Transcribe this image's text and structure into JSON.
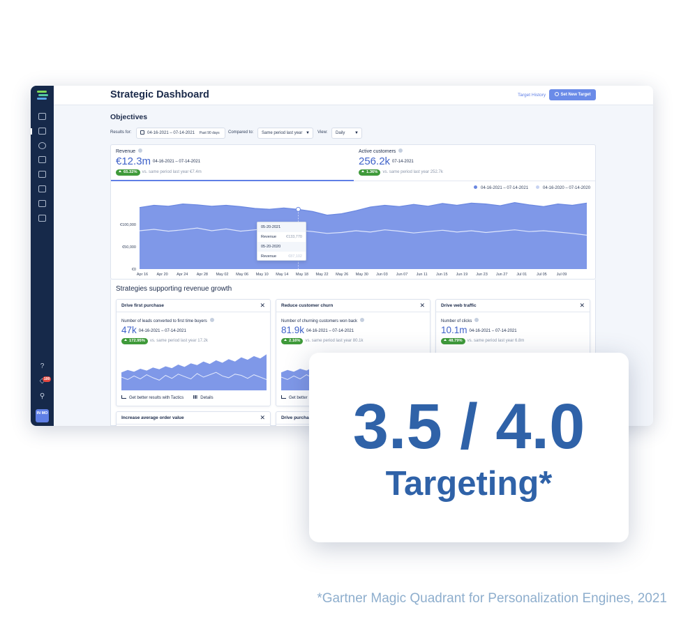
{
  "app": {
    "page_title": "Strategic Dashboard",
    "target_history": "Target History",
    "new_target_button": "Set New Target",
    "notification_count": "100",
    "avatar_initials": "IN MO"
  },
  "objectives": {
    "title": "Objectives",
    "filters": {
      "results_for_label": "Results for:",
      "date_range": "04-16-2021 – 07-14-2021",
      "date_hint": "Past 90 days",
      "compared_to_label": "Compared to:",
      "compared_value": "Same period last year",
      "view_label": "View:",
      "view_value": "Daily"
    },
    "kpis": [
      {
        "label": "Revenue",
        "value": "€12.3m",
        "range": "04-16-2021 – 07-14-2021",
        "delta": "65.32%",
        "compare_text": "vs. same period last year €7.4m"
      },
      {
        "label": "Active customers",
        "value": "256.2k",
        "range": "07-14-2021",
        "delta": "1.36%",
        "compare_text": "vs. same period last year 252.7k"
      }
    ],
    "legend": [
      {
        "name": "04-16-2021 – 07-14-2021",
        "color": "#6a87e0"
      },
      {
        "name": "04-16-2020 – 07-14-2020",
        "color": "#c7d3f2"
      }
    ],
    "tooltip": {
      "date_current": "05-20-2021",
      "label_current": "Revenue",
      "value_current": "€133,770",
      "date_previous": "05-20-2020",
      "label_previous": "Revenue",
      "value_previous": "€87,102"
    }
  },
  "chart_data": {
    "type": "area",
    "title": "",
    "xlabel": "",
    "ylabel": "",
    "ylim": [
      0,
      175000
    ],
    "y_ticks": [
      0,
      50000,
      100000
    ],
    "y_tick_labels": [
      "€0",
      "€50,000",
      "€100,000"
    ],
    "x_tick_labels": [
      "Apr 16",
      "Apr 20",
      "Apr 24",
      "Apr 28",
      "May 02",
      "May 06",
      "May 10",
      "May 14",
      "May 18",
      "May 22",
      "May 26",
      "May 30",
      "Jun 03",
      "Jun 07",
      "Jun 11",
      "Jun 15",
      "Jun 19",
      "Jun 23",
      "Jun 27",
      "Jul 01",
      "Jul 05",
      "Jul 09"
    ],
    "grid": false,
    "legend_position": "top-right",
    "series": [
      {
        "name": "04-16-2021 – 07-14-2021",
        "values": [
          138000,
          143000,
          141000,
          146000,
          144000,
          141000,
          143000,
          140000,
          136000,
          134000,
          137000,
          133770,
          129000,
          121000,
          124000,
          131000,
          139000,
          143000,
          140000,
          145000,
          141000,
          147000,
          143000,
          148000,
          146000,
          142000,
          149000,
          144000,
          140000,
          146000,
          143000,
          148000
        ]
      },
      {
        "name": "04-16-2020 – 07-14-2020",
        "values": [
          86000,
          89000,
          85000,
          88000,
          92000,
          86000,
          90000,
          85000,
          88000,
          91000,
          87000,
          87102,
          84000,
          80000,
          82000,
          86000,
          83000,
          88000,
          85000,
          81000,
          84000,
          87000,
          83000,
          86000,
          82000,
          85000,
          88000,
          84000,
          86000,
          83000,
          80000,
          76000
        ]
      }
    ]
  },
  "strategies": {
    "title": "Strategies supporting revenue growth",
    "cards": [
      {
        "title": "Drive first purchase",
        "metric": "Number of leads converted to first time buyers",
        "value": "47k",
        "range": "04-16-2021 – 07-14-2021",
        "delta": "172.95%",
        "compare_text": "vs. same period last year 17.2k",
        "tactics_link": "Get better results with Tactics",
        "details_link": "Details"
      },
      {
        "title": "Reduce customer churn",
        "metric": "Number of churning customers won back",
        "value": "81.9k",
        "range": "04-16-2021 – 07-14-2021",
        "delta": "2.16%",
        "compare_text": "vs. same period last year 80.1k",
        "tactics_link": "Get better",
        "details_link": ""
      },
      {
        "title": "Drive web traffic",
        "metric": "Number of clicks",
        "value": "10.1m",
        "range": "04-16-2021 – 07-14-2021",
        "delta": "48.79%",
        "compare_text": "vs. same period last year 6.8m",
        "tactics_link": "",
        "details_link": ""
      },
      {
        "title": "Increase average order value"
      },
      {
        "title": "Drive purcha"
      }
    ],
    "card_sparkline": {
      "current": [
        30,
        34,
        31,
        36,
        33,
        38,
        35,
        40,
        37,
        43,
        39,
        45,
        42,
        48,
        44,
        50,
        46,
        52,
        48,
        55,
        51,
        57,
        53,
        60
      ],
      "previous": [
        22,
        18,
        24,
        19,
        26,
        21,
        17,
        25,
        20,
        27,
        23,
        19,
        28,
        22,
        26,
        30,
        24,
        21,
        27,
        25,
        20,
        26,
        22,
        18
      ]
    }
  },
  "rating": {
    "score": "3.5 / 4.0",
    "label": "Targeting*"
  },
  "footnote": "*Gartner Magic Quadrant for Personalization Engines, 2021"
}
